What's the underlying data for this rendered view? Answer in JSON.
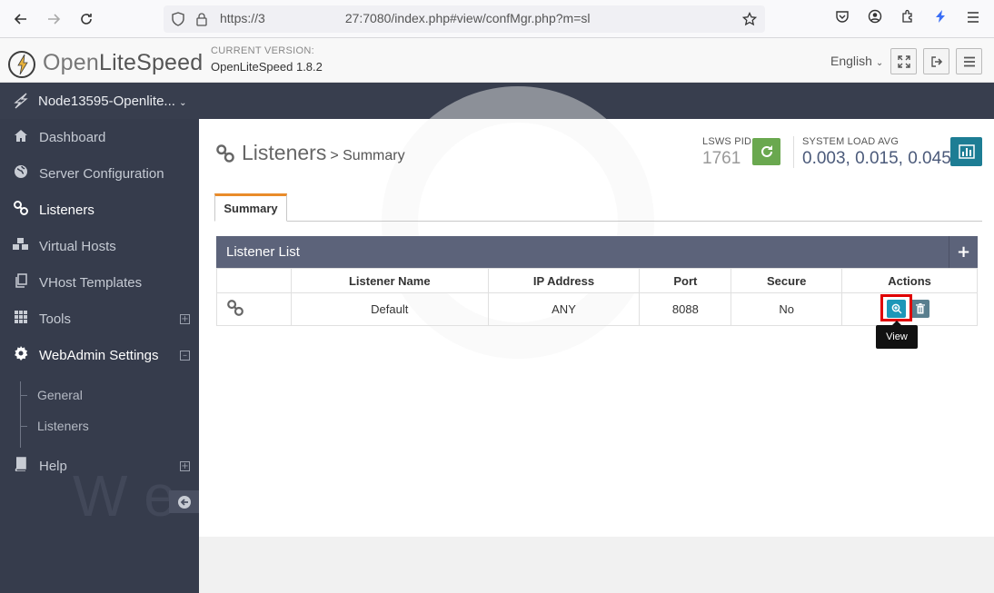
{
  "browser": {
    "url_prefix": "https://3",
    "url_suffix": "27:7080/index.php#view/confMgr.php?m=sl"
  },
  "header": {
    "logo_open": "Open",
    "logo_lite": "LiteSpeed",
    "current_version_label": "CURRENT VERSION:",
    "current_version": "OpenLiteSpeed 1.8.2",
    "language": "English"
  },
  "node": {
    "name": "Node13595-Openlite..."
  },
  "sidebar": {
    "items": [
      {
        "label": "Dashboard",
        "icon": "home-icon"
      },
      {
        "label": "Server Configuration",
        "icon": "globe-icon"
      },
      {
        "label": "Listeners",
        "icon": "link-icon"
      },
      {
        "label": "Virtual Hosts",
        "icon": "cubes-icon"
      },
      {
        "label": "VHost Templates",
        "icon": "copy-icon"
      },
      {
        "label": "Tools",
        "icon": "grid-icon"
      },
      {
        "label": "WebAdmin Settings",
        "icon": "gear-icon"
      },
      {
        "label": "Help",
        "icon": "book-icon"
      }
    ],
    "subitems": [
      {
        "label": "General"
      },
      {
        "label": "Listeners"
      }
    ],
    "watermark": "W e"
  },
  "page": {
    "title": "Listeners",
    "subtitle": "> Summary",
    "pid_label": "LSWS PID",
    "pid_value": "1761",
    "load_label": "SYSTEM LOAD AVG",
    "load_value": "0.003, 0.015, 0.045",
    "tab": "Summary"
  },
  "panel": {
    "title": "Listener List",
    "add": "+"
  },
  "table": {
    "headers": [
      "",
      "Listener Name",
      "IP Address",
      "Port",
      "Secure",
      "Actions"
    ],
    "rows": [
      {
        "name": "Default",
        "ip": "ANY",
        "port": "8088",
        "secure": "No"
      }
    ]
  },
  "tooltip": "View",
  "colors": {
    "accent_tab": "#e98b2a",
    "sidebar_bg": "#363c4c",
    "panel_head": "#5c637a",
    "view_button": "#1d97b8",
    "reload_button": "#6aa84f",
    "highlight": "#e00000"
  }
}
